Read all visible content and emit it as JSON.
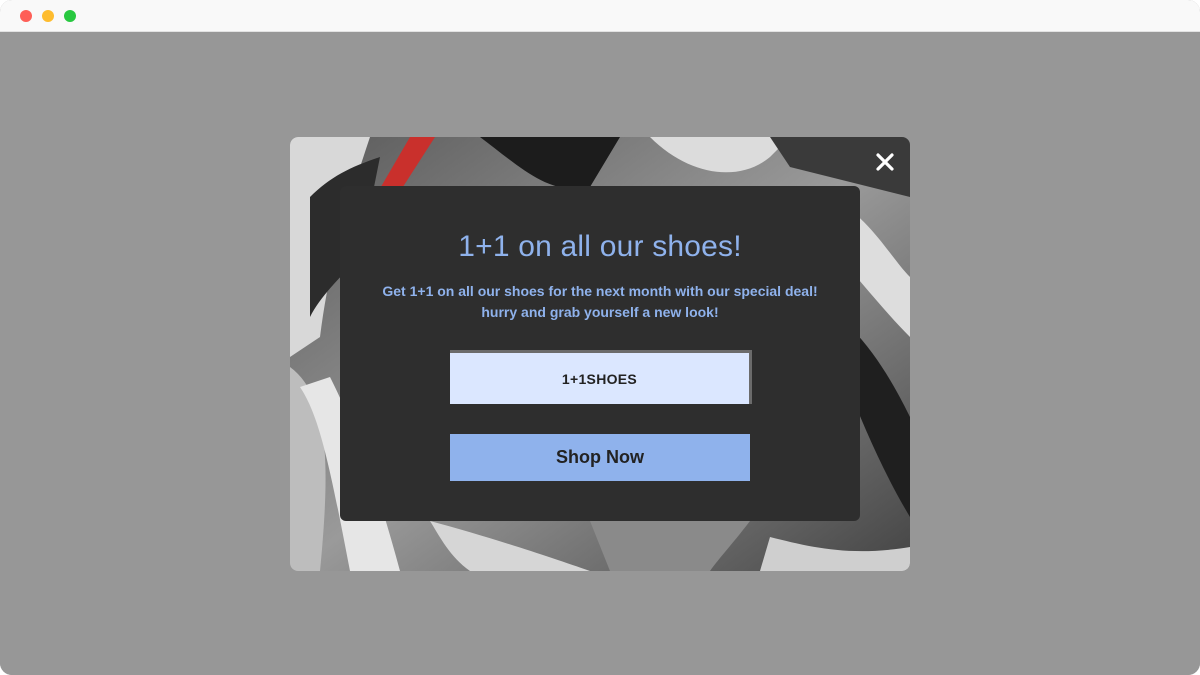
{
  "window": {
    "controls": [
      "close",
      "minimize",
      "maximize"
    ]
  },
  "popup": {
    "close_icon": "close-icon",
    "title": "1+1 on all our shoes!",
    "description_line1": "Get 1+1 on all our shoes for the next month with our special deal!",
    "description_line2": "hurry and grab yourself a new look!",
    "coupon_code": "1+1SHOES",
    "cta_label": "Shop Now"
  },
  "colors": {
    "overlay": "#979797",
    "card": "#2e2e2e",
    "accent": "#8fb2ec",
    "coupon_bg": "#dbe7ff"
  }
}
